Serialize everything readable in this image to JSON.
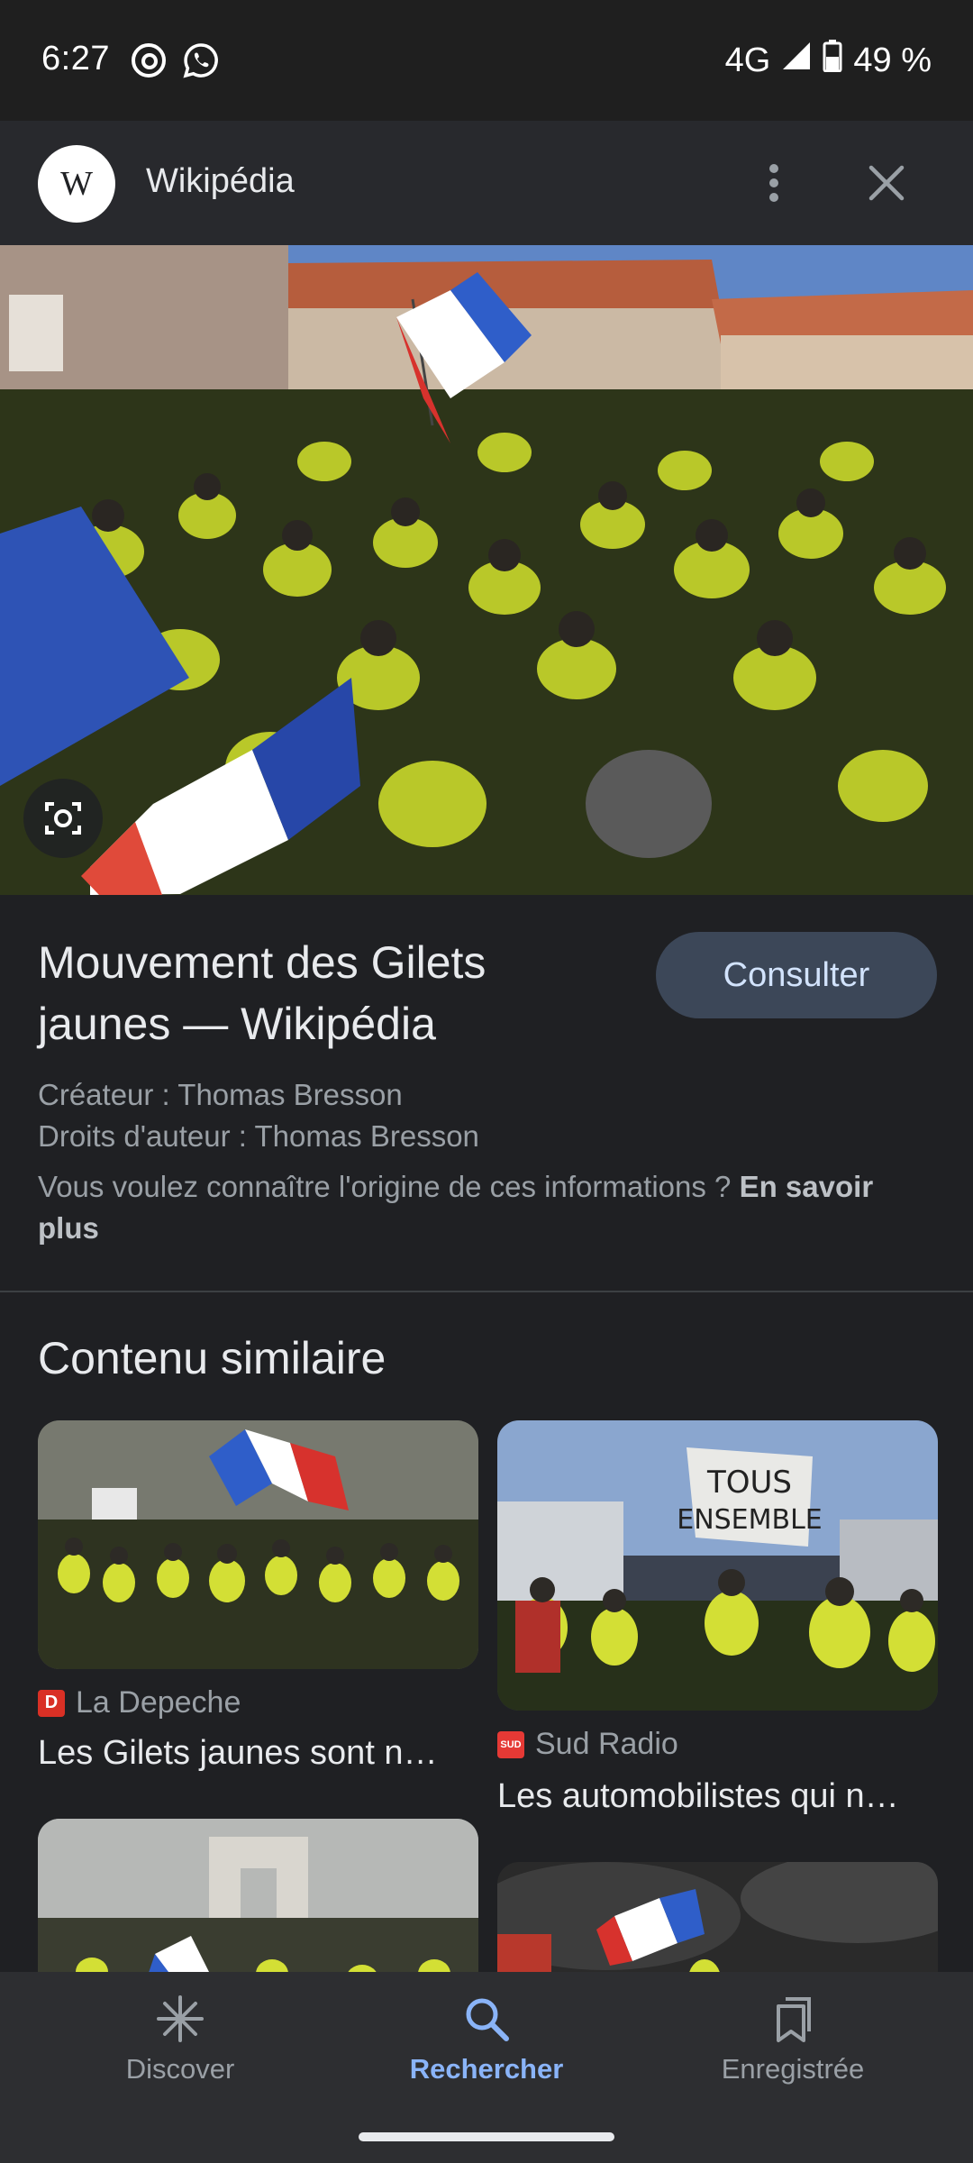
{
  "status_bar": {
    "time": "6:27",
    "network": "4G",
    "battery": "49 %",
    "icons": [
      "threads-icon",
      "whatsapp-icon",
      "signal-icon",
      "battery-icon"
    ]
  },
  "header": {
    "logo_letter": "W",
    "title": "Wikipédia",
    "icons": [
      "more-vert-icon",
      "close-icon"
    ]
  },
  "result": {
    "title": "Mouvement des Gilets jaunes — Wikipédia",
    "visit_label": "Consulter",
    "creator": "Créateur : Thomas Bresson",
    "copyright": "Droits d'auteur : Thomas Bresson",
    "info_text": "Vous voulez connaître l'origine de ces informations ?",
    "learn_more": "En savoir plus"
  },
  "similar": {
    "title": "Contenu similaire",
    "items": [
      {
        "source": "La Depeche",
        "title": "Les Gilets jaunes sont n…",
        "favicon": "D",
        "favicon_color": "#d93025"
      },
      {
        "source": "Sud Radio",
        "title": "Les automobilistes qui n…",
        "favicon": "SUD",
        "favicon_color": "#e53935"
      }
    ],
    "sign_text": "TOUS ENSEMBLE"
  },
  "bottom_nav": {
    "items": [
      {
        "label": "Discover",
        "icon": "asterisk-icon",
        "active": false
      },
      {
        "label": "Rechercher",
        "icon": "search-icon",
        "active": true
      },
      {
        "label": "Enregistrée",
        "icon": "bookmarks-icon",
        "active": false
      }
    ]
  },
  "colors": {
    "background": "#1f2023",
    "accent": "#8ab4f8",
    "button": "#3c4758"
  }
}
